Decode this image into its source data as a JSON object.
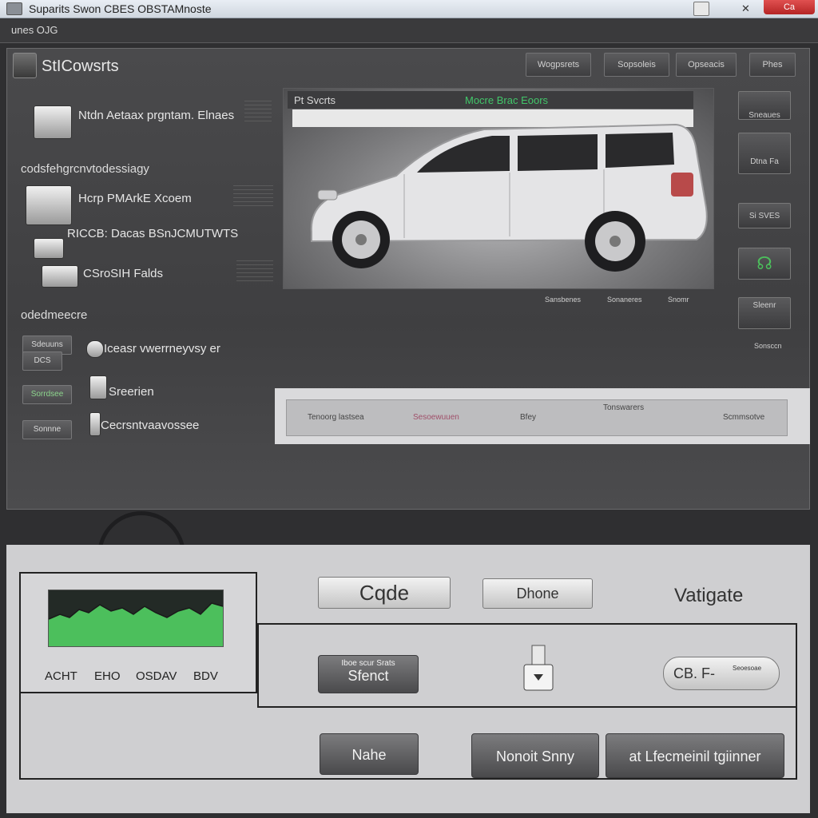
{
  "window": {
    "title": "Suparits Swon CBES OBSTAMnoste",
    "close_label": "Ca"
  },
  "menubar": {
    "item": "unes OJG"
  },
  "header": {
    "title": "StICowsrts",
    "buttons": [
      "Wogpsrets",
      "Sopsoleis",
      "Opseacis",
      "Phes"
    ]
  },
  "left": {
    "item1": "Ntdn Aetaax prgntam. Elnaes",
    "section1": "codsfehgrcnvtodessiagy",
    "item2": "Hcrp PMArkE Xcoem",
    "item3": "RICCB: Dacas BSnJCMUTWTS",
    "item4": "CSroSIH Falds",
    "section2": "odedmeecre",
    "btn1": "Sdeuuns",
    "btn2": "DCS",
    "btn3": "Sorrdsee",
    "btn4": "Sonnne",
    "item5": "Iceasr vwerrneyvsy er",
    "item6": "Sreerien",
    "item7": "Cecrsntvaavossee"
  },
  "vehicle": {
    "header_left": "Pt Svcrts",
    "header_right": "Mocre Brac Eoors",
    "footer": [
      "Sansbenes",
      "Sonaneres",
      "Snomr"
    ]
  },
  "right": {
    "b1": "Sneaues",
    "b2": "Dtna Fa",
    "b3": "Si SVES",
    "b4": "Sleenr",
    "b5": "Sonsccn"
  },
  "strip": {
    "a": "Tenoorg lastsea",
    "b": "Sesoewuuen",
    "c": "Bfey",
    "d": "Tonswarers",
    "e": "Scmmsotve"
  },
  "device": {
    "graph_labels": [
      "ACHT",
      "EHO",
      "OSDAV",
      "BDV"
    ],
    "code_btn": "Cqde",
    "phone_btn": "Dhone",
    "nav_label": "Vatigate",
    "send_small": "Iboe scur Srats",
    "send_btn": "Sfenct",
    "pill": "CB. F-",
    "pill_small": "Seoesoae",
    "name_btn": "Nahe",
    "submit_btn": "Nonoit Snny",
    "manager_btn": "at Lfecmeinil tgiinner"
  },
  "colors": {
    "graph_fill": "#4cbf5c",
    "accent_green": "#42c66a",
    "close_red": "#c83232"
  }
}
